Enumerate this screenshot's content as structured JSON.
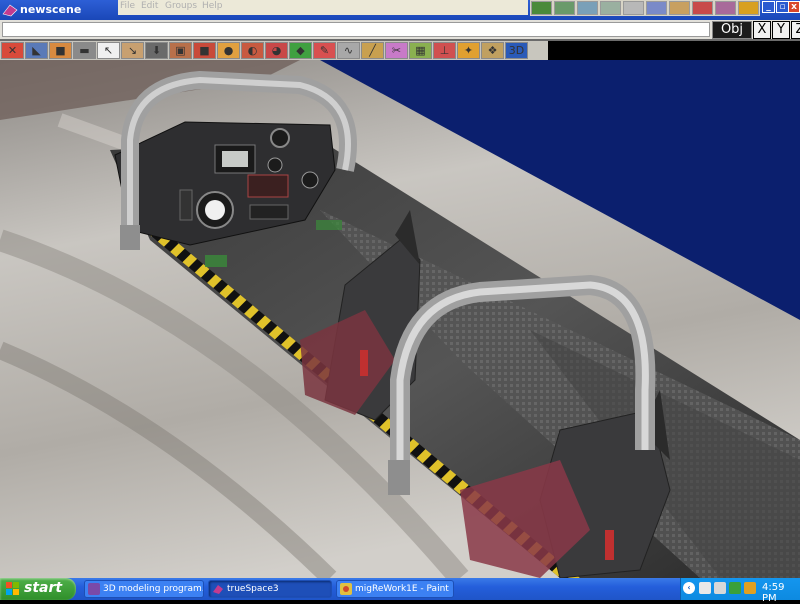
{
  "window": {
    "title": "newscene"
  },
  "menu": [
    "File",
    "Edit",
    "Groups",
    "Help"
  ],
  "window_controls": {
    "minimize": "_",
    "maximize": "▫",
    "close": "x"
  },
  "axis_bar": {
    "obj": "Obj",
    "x": "X",
    "y": "Y",
    "z": "Z"
  },
  "toolbar": {
    "icons": [
      "delete-object-icon",
      "eye-nav-icon",
      "object-cube-icon",
      "camera-icon",
      "select-arrow-icon",
      "object-move-icon",
      "down-hierarchy-icon",
      "cube-tools-icon",
      "cube-red-icon",
      "sphere-primitive-icon",
      "material-ball-icon",
      "paint-icon",
      "deform-icon",
      "point-edit-icon",
      "curve-icon",
      "sweep-icon",
      "lathe-icon",
      "render-cube-icon",
      "axes-icon",
      "lights-icon",
      "texture-icon",
      "3d-view-icon"
    ],
    "labels": [
      "✕",
      "◣",
      "■",
      "▬",
      "↖",
      "↘",
      "⬇",
      "▣",
      "■",
      "●",
      "◐",
      "◕",
      "◆",
      "✎",
      "∿",
      "╱",
      "✂",
      "▦",
      "⊥",
      "✦",
      "❖",
      "3D"
    ]
  },
  "scene_description": "",
  "taskbar": {
    "start": "start",
    "tasks": [
      {
        "label": "3D modeling program...",
        "active": false
      },
      {
        "label": "trueSpace3",
        "active": true
      },
      {
        "label": "migReWork1E - Paint",
        "active": false
      }
    ],
    "clock": "4:59 PM"
  },
  "colors": {
    "title_blue": "#1a47b8",
    "viewport_sky": "#0b1f6e",
    "fuselage_gray": "#b8b4ae",
    "canopy_frame": "#9a9a9a",
    "hazard_yellow": "#e0c22a",
    "seat_red": "#9a3a48",
    "taskbar_blue": "#245edb",
    "start_green": "#3a9c35"
  }
}
